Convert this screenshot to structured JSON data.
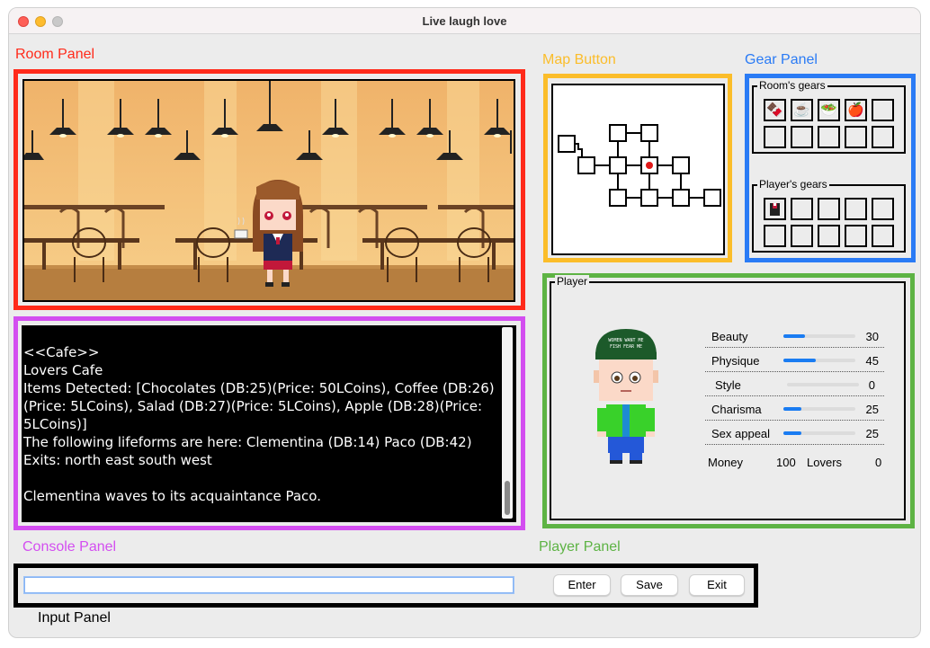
{
  "window": {
    "title": "Live laugh love"
  },
  "labels": {
    "room_panel": "Room Panel",
    "map_button": "Map Button",
    "gear_panel": "Gear Panel",
    "console_panel": "Console Panel",
    "player_panel": "Player Panel",
    "input_panel": "Input Panel"
  },
  "colors": {
    "room": "#ff2a1a",
    "map": "#fbbd2a",
    "gear": "#2a7bf5",
    "console": "#d34ef0",
    "player": "#5db344",
    "input": "#000000"
  },
  "console": {
    "lines": [
      "<<Cafe>>",
      "Lovers Cafe",
      "Items Detected: [Chocolates (DB:25)(Price: 50LCoins), Coffee (DB:26)(Price: 5LCoins), Salad (DB:27)(Price: 5LCoins), Apple (DB:28)(Price: 5LCoins)]",
      "The following lifeforms are here: Clementina (DB:14) Paco (DB:42)",
      "Exits: north east south west",
      "",
      "Clementina waves to its acquaintance Paco."
    ]
  },
  "gear": {
    "room_title": "Room's gears",
    "player_title": "Player's gears",
    "room_items": [
      "chocolates-icon",
      "coffee-icon",
      "salad-icon",
      "apple-icon"
    ],
    "player_items": [
      "jacket-icon"
    ]
  },
  "player": {
    "title": "Player",
    "stats": [
      {
        "label": "Beauty",
        "value": "30",
        "level": 0.3
      },
      {
        "label": "Physique",
        "value": "45",
        "level": 0.45
      },
      {
        "label": "Style",
        "value": "0",
        "level": 0.0
      },
      {
        "label": "Charisma",
        "value": "25",
        "level": 0.25
      },
      {
        "label": "Sex appeal",
        "value": "25",
        "level": 0.25
      }
    ],
    "money_label": "Money",
    "money_value": "100",
    "lovers_label": "Lovers",
    "lovers_value": "0",
    "cap_text": "WOMEN WANT ME FISH FEAR ME"
  },
  "input": {
    "value": "",
    "enter_label": "Enter",
    "save_label": "Save",
    "exit_label": "Exit"
  }
}
